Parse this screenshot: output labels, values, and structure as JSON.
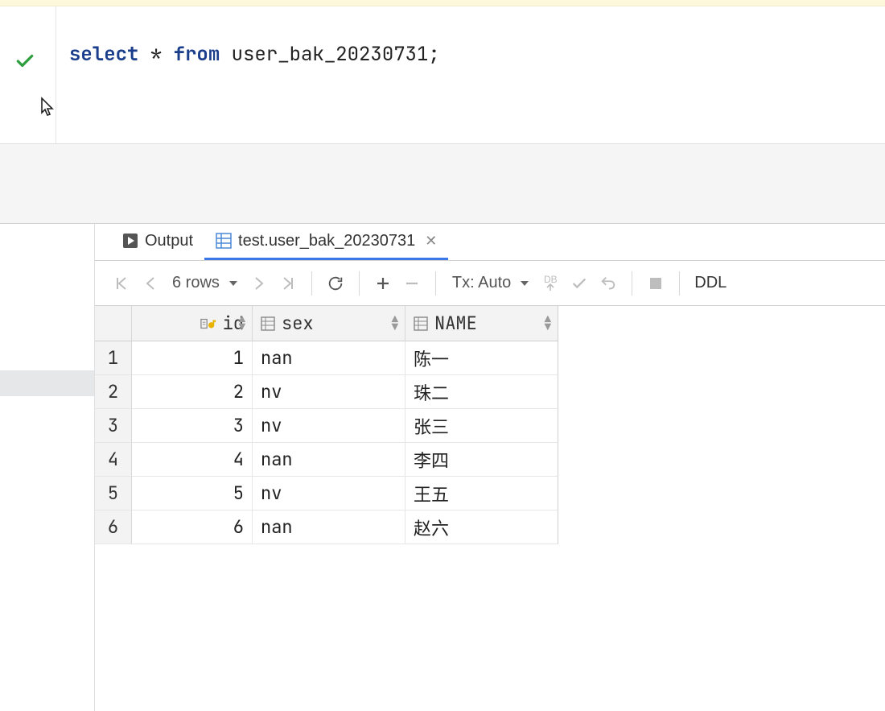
{
  "editor": {
    "sql_keywords": {
      "select": "select",
      "from": "from"
    },
    "sql_star": "*",
    "sql_rest": " user_bak_20230731;"
  },
  "tabs": {
    "output_label": "Output",
    "active_label": "test.user_bak_20230731"
  },
  "toolbar": {
    "row_count_text": "6 rows",
    "tx_label": "Tx: Auto",
    "db_label": "DB",
    "ddl_label": "DDL"
  },
  "columns": {
    "id": "id",
    "sex": "sex",
    "name": "NAME"
  },
  "rows": [
    {
      "n": "1",
      "id": "1",
      "sex": "nan",
      "name": "陈一"
    },
    {
      "n": "2",
      "id": "2",
      "sex": "nv",
      "name": "珠二"
    },
    {
      "n": "3",
      "id": "3",
      "sex": "nv",
      "name": "张三"
    },
    {
      "n": "4",
      "id": "4",
      "sex": "nan",
      "name": "李四"
    },
    {
      "n": "5",
      "id": "5",
      "sex": "nv",
      "name": "王五"
    },
    {
      "n": "6",
      "id": "6",
      "sex": "nan",
      "name": "赵六"
    }
  ]
}
